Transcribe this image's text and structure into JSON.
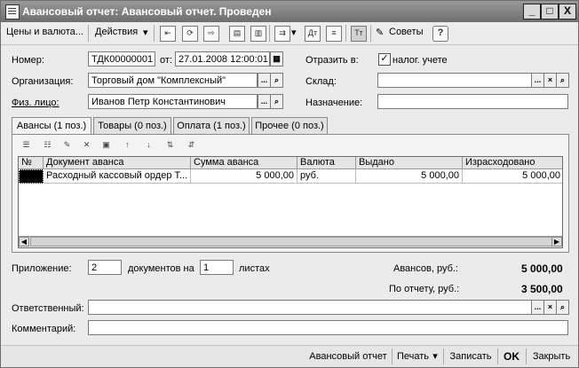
{
  "window": {
    "title": "Авансовый отчет: Авансовый отчет. Проведен",
    "min": "_",
    "max": "□",
    "close": "X"
  },
  "toolbar": {
    "prices_label": "Цены и валюта...",
    "actions_label": "Действия",
    "dropdown_arrow": "▾",
    "tips_label": "Советы",
    "help_label": "?"
  },
  "form": {
    "number_label": "Номер:",
    "number_value": "ТДК00000001",
    "from_label": "от:",
    "date_value": "27.01.2008 12:00:01",
    "reflect_label": "Отразить в:",
    "tax_check_label": "налог. учете",
    "tax_checked": "✓",
    "org_label": "Организация:",
    "org_value": "Торговый дом \"Комплексный\"",
    "warehouse_label": "Склад:",
    "warehouse_value": "",
    "person_label": "Физ. лицо:",
    "person_value": "Иванов  Петр  Константинович",
    "purpose_label": "Назначение:",
    "purpose_value": ""
  },
  "tabs": [
    {
      "label": "Авансы (1 поз.)"
    },
    {
      "label": "Товары (0 поз.)"
    },
    {
      "label": "Оплата (1 поз.)"
    },
    {
      "label": "Прочее (0 поз.)"
    }
  ],
  "grid": {
    "columns": [
      "№",
      "Документ аванса",
      "Сумма аванса",
      "Валюта",
      "Выдано",
      "Израсходовано"
    ],
    "rows": [
      {
        "num": "",
        "doc": "Расходный кассовый ордер Т...",
        "sum": "5 000,00",
        "currency": "руб.",
        "issued": "5 000,00",
        "spent": "5 000,00"
      }
    ]
  },
  "footer": {
    "attachment_label": "Приложение:",
    "docs_count": "2",
    "docs_on_label": "документов на",
    "sheets_count": "1",
    "sheets_label": "листах",
    "advances_label": "Авансов, руб.:",
    "advances_value": "5 000,00",
    "report_label": "По отчету, руб.:",
    "report_value": "3 500,00",
    "responsible_label": "Ответственный:",
    "responsible_value": "",
    "comment_label": "Комментарий:",
    "comment_value": ""
  },
  "bottom": {
    "report_btn": "Авансовый отчет",
    "print_btn": "Печать",
    "save_btn": "Записать",
    "ok_btn": "OK",
    "close_btn": "Закрыть"
  }
}
